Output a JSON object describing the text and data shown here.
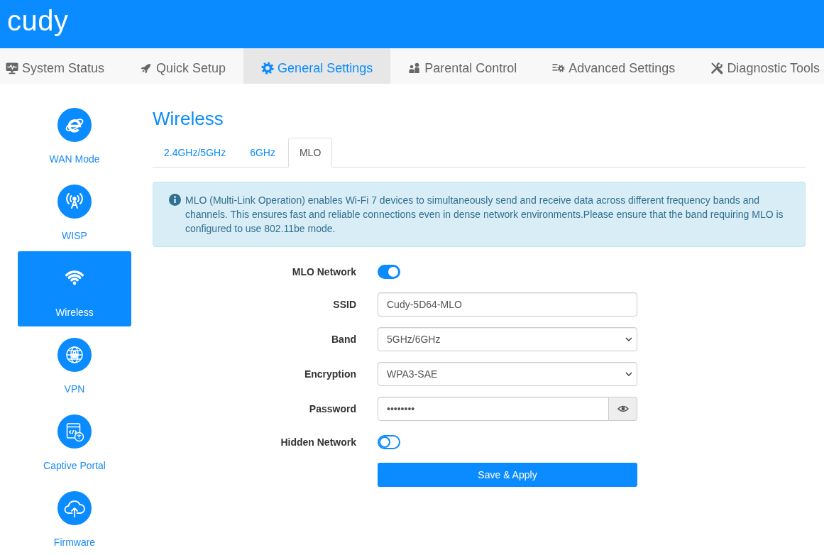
{
  "header": {
    "logo": "cudy"
  },
  "nav": [
    {
      "label": "System Status",
      "selected": false
    },
    {
      "label": "Quick Setup",
      "selected": false
    },
    {
      "label": "General Settings",
      "selected": true
    },
    {
      "label": "Parental Control",
      "selected": false
    },
    {
      "label": "Advanced Settings",
      "selected": false
    },
    {
      "label": "Diagnostic Tools",
      "selected": false
    }
  ],
  "sidebar": {
    "items": [
      {
        "label": "WAN Mode",
        "selected": false
      },
      {
        "label": "WISP",
        "selected": false
      },
      {
        "label": "Wireless",
        "selected": true
      },
      {
        "label": "VPN",
        "selected": false
      },
      {
        "label": "Captive Portal",
        "selected": false
      },
      {
        "label": "Firmware",
        "selected": false
      }
    ]
  },
  "page": {
    "title": "Wireless",
    "tabs": [
      {
        "label": "2.4GHz/5GHz",
        "selected": false
      },
      {
        "label": "6GHz",
        "selected": false
      },
      {
        "label": "MLO",
        "selected": true
      }
    ],
    "alert": "MLO (Multi-Link Operation) enables Wi-Fi 7 devices to simultaneously send and receive data across different frequency bands and channels. This ensures fast and reliable connections even in dense network environments.Please ensure that the band requiring MLO is configured to use 802.11be mode.",
    "form": {
      "fields": [
        {
          "kind": "toggle",
          "label": "MLO Network",
          "on": true
        },
        {
          "kind": "text",
          "label": "SSID",
          "value": "Cudy-5D64-MLO"
        },
        {
          "kind": "select",
          "label": "Band",
          "value": "5GHz/6GHz"
        },
        {
          "kind": "select",
          "label": "Encryption",
          "value": "WPA3-SAE"
        },
        {
          "kind": "password",
          "label": "Password",
          "value": "••••••••"
        },
        {
          "kind": "toggle",
          "label": "Hidden Network",
          "on": false
        }
      ],
      "submit": "Save & Apply"
    }
  }
}
